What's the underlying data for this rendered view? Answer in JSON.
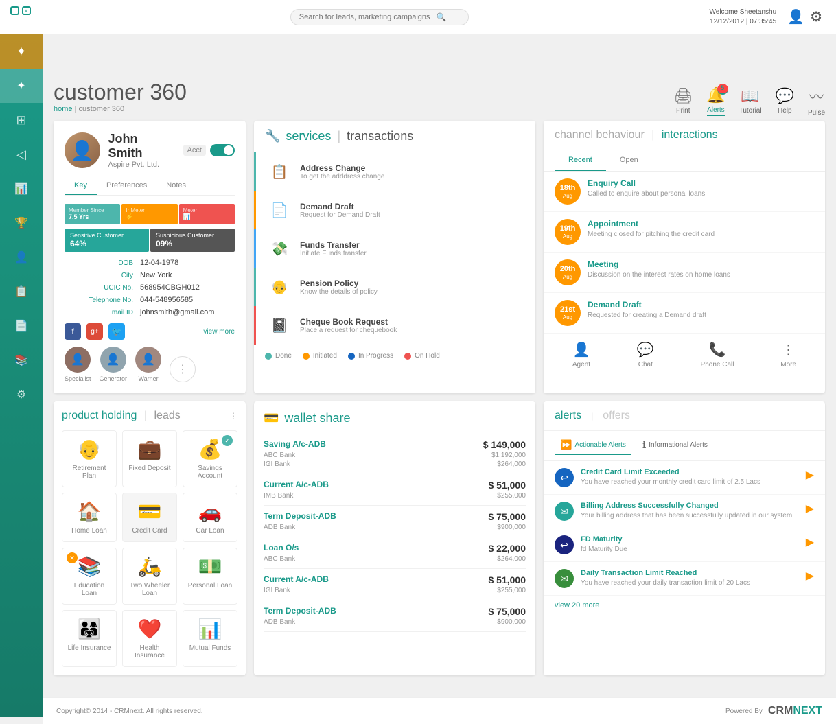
{
  "header": {
    "logo_text": "CRMNEXT",
    "search_placeholder": "Search for leads, marketing campaigns",
    "welcome": "Welcome Sheetanshu",
    "datetime": "12/12/2012 | 07:35:45"
  },
  "action_icons": [
    {
      "id": "print",
      "label": "Print",
      "icon": "🖨",
      "active": false
    },
    {
      "id": "alerts",
      "label": "Alerts",
      "icon": "🔔",
      "active": true,
      "badge": "5"
    },
    {
      "id": "tutorial",
      "label": "Tutorial",
      "icon": "📖",
      "active": false
    },
    {
      "id": "help",
      "label": "Help",
      "icon": "💬",
      "active": false
    },
    {
      "id": "pulse",
      "label": "Pulse",
      "icon": "〰",
      "active": false
    }
  ],
  "breadcrumb": {
    "home": "home",
    "current": "customer 360"
  },
  "page_title": "customer 360",
  "sidebar": {
    "items": [
      {
        "icon": "◈",
        "name": "orange-nav",
        "active": true
      },
      {
        "icon": "✦",
        "name": "star-nav"
      },
      {
        "icon": "⊞",
        "name": "grid-nav"
      },
      {
        "icon": "◁",
        "name": "arrow-nav"
      },
      {
        "icon": "▦",
        "name": "chart-nav"
      },
      {
        "icon": "🏆",
        "name": "trophy-nav"
      },
      {
        "icon": "👤",
        "name": "user-nav"
      },
      {
        "icon": "📋",
        "name": "clipboard-nav"
      },
      {
        "icon": "◻",
        "name": "square-nav"
      },
      {
        "icon": "📚",
        "name": "book-nav"
      },
      {
        "icon": "⊕",
        "name": "plus-nav"
      }
    ]
  },
  "customer": {
    "name": "John Smith",
    "company": "Aspire Pvt. Ltd.",
    "acct_label": "Acct",
    "dob_label": "DOB",
    "dob": "12-04-1978",
    "city_label": "City",
    "city": "New York",
    "ucic_label": "UCIC No.",
    "ucic": "568954CBGH012",
    "phone_label": "Telephone No.",
    "phone": "044-548956585",
    "email_label": "Email ID",
    "email": "johnsmith@gmail.com",
    "stats": {
      "member_since_label": "Member Since",
      "member_since": "7.5 Yrs",
      "ir_meter": "Ir Meter",
      "sensitive_label": "Sensitive Customer",
      "sensitive_pct": "64%",
      "suspicious_label": "Suspicious Customer",
      "suspicious_pct": "09%"
    },
    "tabs": [
      "Key",
      "Preferences",
      "Notes"
    ],
    "contacts": [
      {
        "name": "Specialist",
        "icon": "👤"
      },
      {
        "name": "Generator",
        "icon": "👤"
      },
      {
        "name": "Warner",
        "icon": "👤"
      }
    ],
    "view_more": "view more"
  },
  "services": {
    "title_svc": "services",
    "title_trans": "transactions",
    "items": [
      {
        "id": "address",
        "title": "Address Change",
        "desc": "To get the adddress change",
        "border": "green"
      },
      {
        "id": "demand",
        "title": "Demand Draft",
        "desc": "Request for Demand Draft",
        "border": "orange"
      },
      {
        "id": "funds",
        "title": "Funds Transfer",
        "desc": "Initiate Funds transfer",
        "border": "blue"
      },
      {
        "id": "pension",
        "title": "Pension Policy",
        "desc": "Know the details of policy",
        "border": "green"
      },
      {
        "id": "cheque",
        "title": "Cheque Book Request",
        "desc": "Place a request for chequebook",
        "border": "red"
      }
    ],
    "statuses": [
      {
        "label": "Done",
        "color": "green"
      },
      {
        "label": "Initiated",
        "color": "orange"
      },
      {
        "label": "In Progress",
        "color": "blue"
      },
      {
        "label": "On Hold",
        "color": "red"
      }
    ]
  },
  "channel": {
    "title": "channel behaviour",
    "title_inter": "interactions",
    "tabs": [
      "Recent",
      "Open"
    ],
    "active_tab": "Recent",
    "timeline": [
      {
        "day": "18th",
        "month": "Aug",
        "title": "Enquiry Call",
        "desc": "Called to enquire about personal loans"
      },
      {
        "day": "19th",
        "month": "Aug",
        "title": "Appointment",
        "desc": "Meeting closed for pitching the credit card"
      },
      {
        "day": "20th",
        "month": "Aug",
        "title": "Meeting",
        "desc": "Discussion on the interest rates on home loans"
      },
      {
        "day": "21st",
        "month": "Aug",
        "title": "Demand Draft",
        "desc": "Requested for creating a Demand draft"
      }
    ],
    "actions": [
      {
        "icon": "👤",
        "label": "Agent"
      },
      {
        "icon": "💬",
        "label": "Chat"
      },
      {
        "icon": "📞",
        "label": "Phone Call"
      },
      {
        "icon": "⋯",
        "label": "More"
      }
    ]
  },
  "product_holding": {
    "title_ph": "product holding",
    "title_leads": "leads",
    "products": [
      {
        "name": "Retirement Plan",
        "icon": "👴",
        "has_check": false,
        "has_x": false
      },
      {
        "name": "Fixed Deposit",
        "icon": "💼",
        "has_check": false,
        "has_x": false
      },
      {
        "name": "Savings Account",
        "icon": "💰",
        "has_check": true,
        "has_x": false
      },
      {
        "name": "Home Loan",
        "icon": "🏠",
        "has_check": false,
        "has_x": false
      },
      {
        "name": "Credit Card",
        "icon": "💳",
        "has_check": false,
        "has_x": false
      },
      {
        "name": "Car Loan",
        "icon": "🚗",
        "has_check": false,
        "has_x": false
      },
      {
        "name": "Education Loan",
        "icon": "📚",
        "has_check": false,
        "has_x": true
      },
      {
        "name": "Two Wheeler Loan",
        "icon": "🛵",
        "has_check": false,
        "has_x": false
      },
      {
        "name": "Personal Loan",
        "icon": "💵",
        "has_check": false,
        "has_x": false
      },
      {
        "name": "Life Insurance",
        "icon": "👨‍👩‍👧",
        "has_check": false,
        "has_x": false
      },
      {
        "name": "Health Insurance",
        "icon": "❤️",
        "has_check": false,
        "has_x": false
      },
      {
        "name": "Mutual Funds",
        "icon": "📊",
        "has_check": false,
        "has_x": false
      }
    ]
  },
  "wallet": {
    "title": "wallet share",
    "icon": "💳",
    "rows": [
      {
        "name": "Saving A/c-ADB",
        "bank1": "ABC Bank",
        "bank2": "IGI Bank",
        "amount": "$ 149,000",
        "sub1": "$1,192,000",
        "sub2": "$264,000"
      },
      {
        "name": "Current A/c-ADB",
        "bank1": "IMB Bank",
        "bank2": "",
        "amount": "$ 51,000",
        "sub1": "$255,000",
        "sub2": ""
      },
      {
        "name": "Term Deposit-ADB",
        "bank1": "ADB Bank",
        "bank2": "",
        "amount": "$ 75,000",
        "sub1": "$900,000",
        "sub2": ""
      },
      {
        "name": "Loan O/s",
        "bank1": "ABC Bank",
        "bank2": "",
        "amount": "$ 22,000",
        "sub1": "$264,000",
        "sub2": ""
      },
      {
        "name": "Current A/c-ADB",
        "bank1": "IGI Bank",
        "bank2": "",
        "amount": "$ 51,000",
        "sub1": "$255,000",
        "sub2": ""
      },
      {
        "name": "Term Deposit-ADB",
        "bank1": "ADB Bank",
        "bank2": "",
        "amount": "$ 75,000",
        "sub1": "$900,000",
        "sub2": ""
      }
    ]
  },
  "alerts": {
    "title": "alerts",
    "offers_title": "offers",
    "sub_tabs": [
      "Actionable Alerts",
      "Informational Alerts"
    ],
    "items": [
      {
        "title": "Credit Card Limit Exceeded",
        "desc": "You have reached your monthly credit card limit of 2.5 Lacs",
        "color": "blue"
      },
      {
        "title": "Billing Address Successfully Changed",
        "desc": "Your billing address that has been successfully updated in our system.",
        "color": "teal"
      },
      {
        "title": "FD Maturity",
        "desc": "fd Maturity Due",
        "color": "navy"
      },
      {
        "title": "Daily Transaction Limit Reached",
        "desc": "You have reached your daily transaction limit of 20 Lacs",
        "color": "green"
      }
    ],
    "view_more": "view 20 more"
  },
  "footer": {
    "copyright": "Copyright© 2014 - CRMnext. All rights reserved.",
    "powered_by": "Powered By",
    "brand_crm": "CRM",
    "brand_next": "NEXT"
  }
}
